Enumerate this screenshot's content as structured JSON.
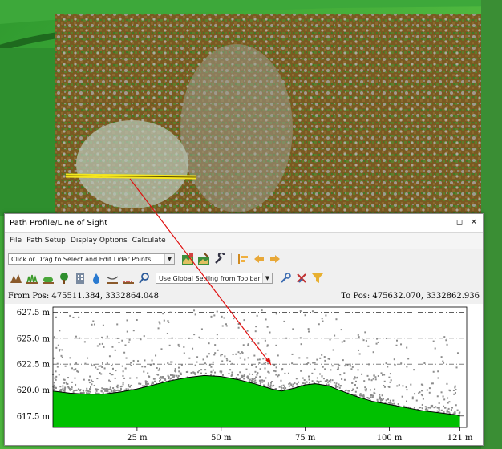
{
  "window": {
    "title": "Path Profile/Line of Sight"
  },
  "menu": [
    "File",
    "Path Setup",
    "Display Options",
    "Calculate"
  ],
  "toolbar1": {
    "mode_select_value": "Click or Drag to Select and Edit Lidar Points",
    "icons": [
      "save-profile-icon",
      "edit-points-icon",
      "wrench-icon",
      "align-left-icon",
      "arrow-left-icon",
      "arrow-right-icon"
    ]
  },
  "toolbar2": {
    "icons": [
      "terrain-icon",
      "grass-icon",
      "shrub-icon",
      "tree-icon",
      "building-icon",
      "water-icon",
      "wire-icon",
      "power-line-icon",
      "search-icon"
    ],
    "classification_select_value": "Use Global Setting from Toolbar",
    "tool_icons": [
      "zoom-tool-icon",
      "clear-tool-icon",
      "filter-icon"
    ]
  },
  "positions": {
    "from_label": "From Pos: 475511.384, 3332864.048",
    "to_label": "To Pos: 475632.070, 3332862.936"
  },
  "chart_data": {
    "type": "area",
    "xlabel": "",
    "ylabel": "",
    "x_ticks": [
      "25 m",
      "50 m",
      "75 m",
      "100 m",
      "121 m"
    ],
    "x_tick_values": [
      25,
      50,
      75,
      100,
      121
    ],
    "y_ticks": [
      "627.5 m",
      "625.0 m",
      "622.5 m",
      "620.0 m",
      "617.5 m"
    ],
    "y_tick_values": [
      627.5,
      625.0,
      622.5,
      620.0,
      617.5
    ],
    "xlim": [
      0,
      123
    ],
    "ylim": [
      616.4,
      628.0
    ],
    "grid": true,
    "ground_profile": {
      "x": [
        0,
        5,
        10,
        15,
        20,
        25,
        30,
        35,
        40,
        45,
        50,
        55,
        60,
        65,
        68,
        72,
        75,
        78,
        82,
        85,
        90,
        95,
        100,
        105,
        110,
        115,
        120,
        121
      ],
      "y": [
        619.9,
        619.7,
        619.6,
        619.6,
        619.8,
        620.1,
        620.5,
        620.9,
        621.2,
        621.4,
        621.3,
        621.0,
        620.6,
        620.1,
        619.9,
        620.2,
        620.5,
        620.6,
        620.4,
        620.0,
        619.4,
        618.9,
        618.6,
        618.3,
        618.0,
        617.8,
        617.6,
        617.5
      ]
    },
    "colors": {
      "ground": "#00c000",
      "ground_line": "#000000",
      "points": "#8c8c8c"
    }
  },
  "map": {
    "line_color": "#f5e61e",
    "arrow_color": "#e01010"
  }
}
